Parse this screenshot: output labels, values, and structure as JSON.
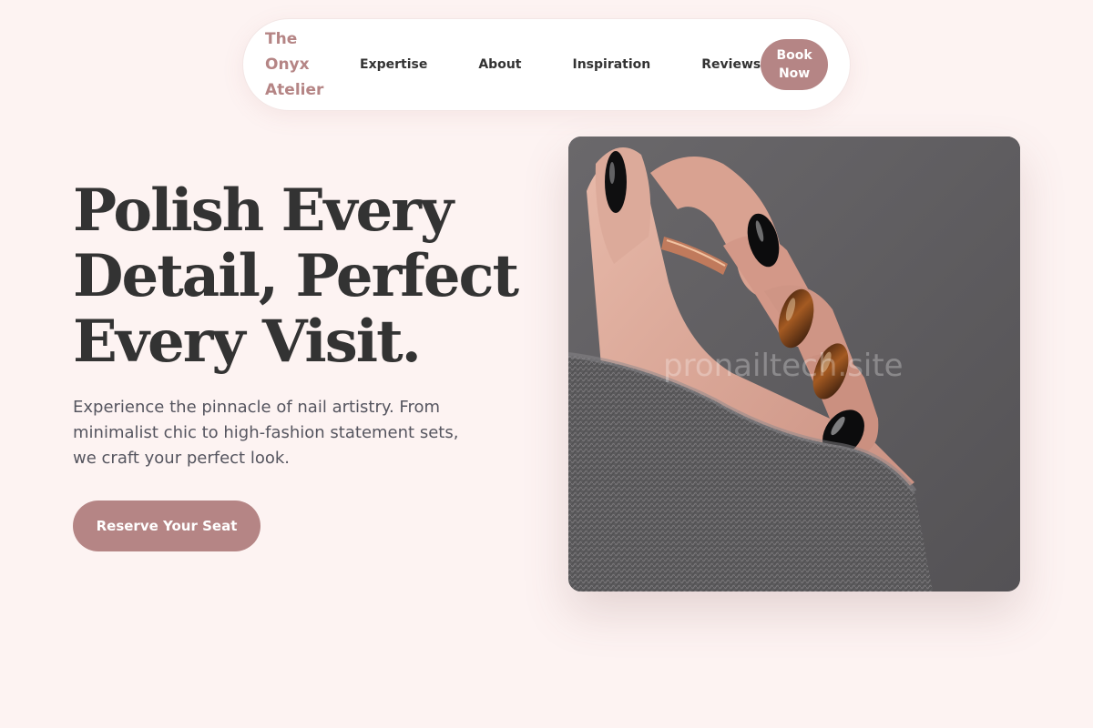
{
  "nav": {
    "brand": "The Onyx Atelier",
    "links": [
      "Expertise",
      "About",
      "Inspiration",
      "Reviews"
    ],
    "book_label": "Book Now"
  },
  "hero": {
    "title": "Polish Every Detail, Perfect Every Visit.",
    "subtitle": "Experience the pinnacle of nail artistry. From minimalist chic to high-fashion statement sets, we craft your perfect look.",
    "cta_label": "Reserve Your Seat",
    "image_watermark": "pronailtech.site"
  },
  "colors": {
    "background": "#fdf3f2",
    "accent": "#b58585",
    "heading": "#333333",
    "body_text": "#55555f"
  }
}
